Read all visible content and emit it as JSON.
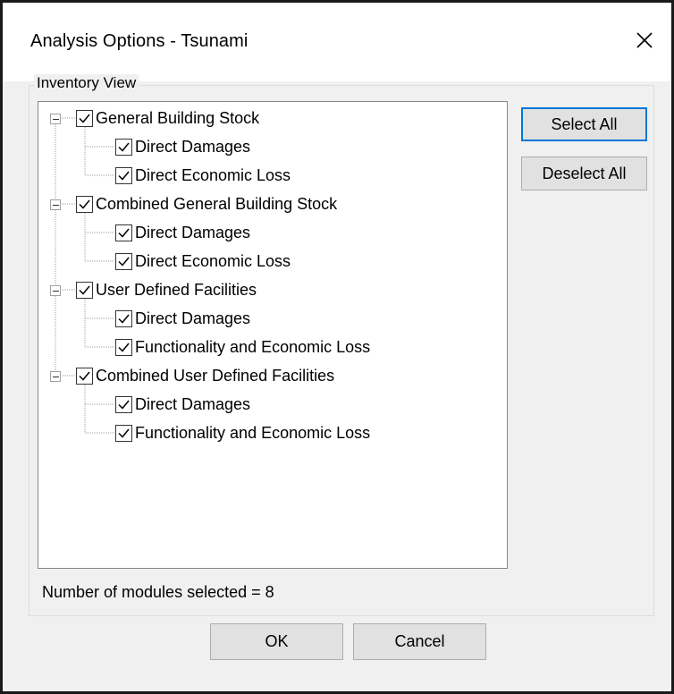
{
  "window": {
    "title": "Analysis Options - Tsunami",
    "close_icon": "close-x-icon"
  },
  "groupbox": {
    "label": "Inventory View"
  },
  "tree": {
    "nodes": [
      {
        "label": "General Building Stock",
        "checked": true,
        "expanded": true,
        "children": [
          {
            "label": "Direct Damages",
            "checked": true
          },
          {
            "label": "Direct Economic Loss",
            "checked": true
          }
        ]
      },
      {
        "label": "Combined General Building Stock",
        "checked": true,
        "expanded": true,
        "children": [
          {
            "label": "Direct Damages",
            "checked": true
          },
          {
            "label": "Direct Economic Loss",
            "checked": true
          }
        ]
      },
      {
        "label": "User Defined Facilities",
        "checked": true,
        "expanded": true,
        "children": [
          {
            "label": "Direct Damages",
            "checked": true
          },
          {
            "label": "Functionality and Economic Loss",
            "checked": true
          }
        ]
      },
      {
        "label": "Combined User Defined Facilities",
        "checked": true,
        "expanded": true,
        "children": [
          {
            "label": "Direct Damages",
            "checked": true
          },
          {
            "label": "Functionality and Economic Loss",
            "checked": true
          }
        ]
      }
    ]
  },
  "buttons": {
    "select_all": "Select All",
    "deselect_all": "Deselect All",
    "ok": "OK",
    "cancel": "Cancel"
  },
  "status": {
    "text": "Number of modules selected = 8"
  },
  "colors": {
    "default_button_border": "#0078d7",
    "tree_lines": "#a0a0a0"
  }
}
